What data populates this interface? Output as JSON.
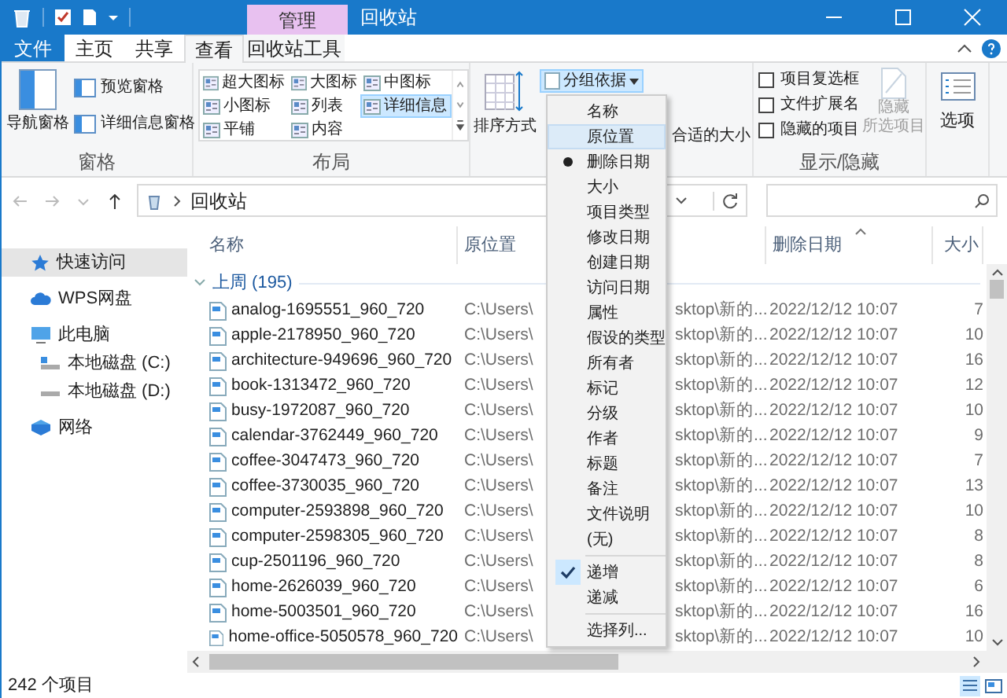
{
  "title_bar": {
    "context_tab": "管理",
    "title": "回收站"
  },
  "ribbon_tabs": [
    {
      "label": "文件",
      "kind": "file",
      "selected": false
    },
    {
      "label": "主页",
      "kind": "tab",
      "selected": false
    },
    {
      "label": "共享",
      "kind": "tab",
      "selected": false
    },
    {
      "label": "查看",
      "kind": "tab",
      "selected": true
    },
    {
      "label": "回收站工具",
      "kind": "context",
      "selected": false
    }
  ],
  "ribbon": {
    "panes": {
      "label": "窗格",
      "navigation_pane": "导航窗格",
      "preview_pane": "预览窗格",
      "details_pane": "详细信息窗格"
    },
    "layout": {
      "label": "布局",
      "options": [
        {
          "label": "超大图标",
          "selected": false
        },
        {
          "label": "大图标",
          "selected": false
        },
        {
          "label": "中图标",
          "selected": false
        },
        {
          "label": "小图标",
          "selected": false
        },
        {
          "label": "列表",
          "selected": false
        },
        {
          "label": "详细信息",
          "selected": true
        },
        {
          "label": "平铺",
          "selected": false
        },
        {
          "label": "内容",
          "selected": false
        }
      ]
    },
    "current_view": {
      "sort_by": "排序方式",
      "group_by": "分组依据",
      "group_by_open": true,
      "fit_columns": "合适的大小"
    },
    "show_hide": {
      "label": "显示/隐藏",
      "checkboxes": [
        {
          "label": "项目复选框",
          "checked": false
        },
        {
          "label": "文件扩展名",
          "checked": false
        },
        {
          "label": "隐藏的项目",
          "checked": false
        }
      ],
      "hide_selected": {
        "lines": [
          "隐藏",
          "所选项目"
        ],
        "disabled": true
      }
    },
    "options": "选项"
  },
  "address_bar": {
    "path": "回收站"
  },
  "nav_pane": {
    "items": [
      {
        "label": "快速访问",
        "kind": "star",
        "selected": true
      },
      {
        "label": "WPS网盘",
        "kind": "cloud",
        "selected": false
      },
      {
        "label": "此电脑",
        "kind": "pc",
        "selected": false,
        "children": [
          {
            "label": "本地磁盘 (C:)",
            "kind": "sysdrive",
            "selected": false
          },
          {
            "label": "本地磁盘 (D:)",
            "kind": "drive",
            "selected": false
          }
        ]
      },
      {
        "label": "网络",
        "kind": "network",
        "selected": false
      }
    ]
  },
  "file_list": {
    "columns": [
      {
        "label": "名称",
        "sorted": false
      },
      {
        "label": "原位置",
        "sorted": false
      },
      {
        "label": "删除日期",
        "sorted": true
      },
      {
        "label": "大小",
        "sorted": false
      }
    ],
    "group": {
      "label": "上周 (195)",
      "expanded": true
    },
    "rows": [
      {
        "name": "analog-1695551_960_720",
        "location_start": "C:\\Users\\",
        "location_end": "sktop\\新的...",
        "deleted": "2022/12/12 10:07",
        "size": "7"
      },
      {
        "name": "apple-2178950_960_720",
        "location_start": "C:\\Users\\",
        "location_end": "sktop\\新的...",
        "deleted": "2022/12/12 10:07",
        "size": "10"
      },
      {
        "name": "architecture-949696_960_720",
        "location_start": "C:\\Users\\",
        "location_end": "sktop\\新的...",
        "deleted": "2022/12/12 10:07",
        "size": "16"
      },
      {
        "name": "book-1313472_960_720",
        "location_start": "C:\\Users\\",
        "location_end": "sktop\\新的...",
        "deleted": "2022/12/12 10:07",
        "size": "12"
      },
      {
        "name": "busy-1972087_960_720",
        "location_start": "C:\\Users\\",
        "location_end": "sktop\\新的...",
        "deleted": "2022/12/12 10:07",
        "size": "10"
      },
      {
        "name": "calendar-3762449_960_720",
        "location_start": "C:\\Users\\",
        "location_end": "sktop\\新的...",
        "deleted": "2022/12/12 10:07",
        "size": "9"
      },
      {
        "name": "coffee-3047473_960_720",
        "location_start": "C:\\Users\\",
        "location_end": "sktop\\新的...",
        "deleted": "2022/12/12 10:07",
        "size": "7"
      },
      {
        "name": "coffee-3730035_960_720",
        "location_start": "C:\\Users\\",
        "location_end": "sktop\\新的...",
        "deleted": "2022/12/12 10:07",
        "size": "13"
      },
      {
        "name": "computer-2593898_960_720",
        "location_start": "C:\\Users\\",
        "location_end": "sktop\\新的...",
        "deleted": "2022/12/12 10:07",
        "size": "10"
      },
      {
        "name": "computer-2598305_960_720",
        "location_start": "C:\\Users\\",
        "location_end": "sktop\\新的...",
        "deleted": "2022/12/12 10:07",
        "size": "8"
      },
      {
        "name": "cup-2501196_960_720",
        "location_start": "C:\\Users\\",
        "location_end": "sktop\\新的...",
        "deleted": "2022/12/12 10:07",
        "size": "8"
      },
      {
        "name": "home-2626039_960_720",
        "location_start": "C:\\Users\\",
        "location_end": "sktop\\新的...",
        "deleted": "2022/12/12 10:07",
        "size": "6"
      },
      {
        "name": "home-5003501_960_720",
        "location_start": "C:\\Users\\",
        "location_end": "sktop\\新的...",
        "deleted": "2022/12/12 10:07",
        "size": "16"
      },
      {
        "name": "home-office-5050578_960_720",
        "location_start": "C:\\Users\\",
        "location_end": "sktop\\新的...",
        "deleted": "2022/12/12 10:07",
        "size": "10"
      }
    ]
  },
  "group_by_menu": {
    "items": [
      {
        "label": "名称",
        "kind": "field",
        "selected": false,
        "hovered": false
      },
      {
        "label": "原位置",
        "kind": "field",
        "selected": false,
        "hovered": true
      },
      {
        "label": "删除日期",
        "kind": "field",
        "selected": true,
        "hovered": false
      },
      {
        "label": "大小",
        "kind": "field",
        "selected": false,
        "hovered": false
      },
      {
        "label": "项目类型",
        "kind": "field",
        "selected": false,
        "hovered": false
      },
      {
        "label": "修改日期",
        "kind": "field",
        "selected": false,
        "hovered": false
      },
      {
        "label": "创建日期",
        "kind": "field",
        "selected": false,
        "hovered": false
      },
      {
        "label": "访问日期",
        "kind": "field",
        "selected": false,
        "hovered": false
      },
      {
        "label": "属性",
        "kind": "field",
        "selected": false,
        "hovered": false
      },
      {
        "label": "假设的类型",
        "kind": "field",
        "selected": false,
        "hovered": false
      },
      {
        "label": "所有者",
        "kind": "field",
        "selected": false,
        "hovered": false
      },
      {
        "label": "标记",
        "kind": "field",
        "selected": false,
        "hovered": false
      },
      {
        "label": "分级",
        "kind": "field",
        "selected": false,
        "hovered": false
      },
      {
        "label": "作者",
        "kind": "field",
        "selected": false,
        "hovered": false
      },
      {
        "label": "标题",
        "kind": "field",
        "selected": false,
        "hovered": false
      },
      {
        "label": "备注",
        "kind": "field",
        "selected": false,
        "hovered": false
      },
      {
        "label": "文件说明",
        "kind": "field",
        "selected": false,
        "hovered": false
      },
      {
        "label": "(无)",
        "kind": "field",
        "selected": false,
        "hovered": false
      },
      {
        "label": "递增",
        "kind": "order",
        "selected": true,
        "hovered": false
      },
      {
        "label": "递减",
        "kind": "order",
        "selected": false,
        "hovered": false
      },
      {
        "label": "选择列...",
        "kind": "command",
        "selected": false,
        "hovered": false
      }
    ]
  },
  "status_bar": {
    "item_count": "242 个项目"
  }
}
